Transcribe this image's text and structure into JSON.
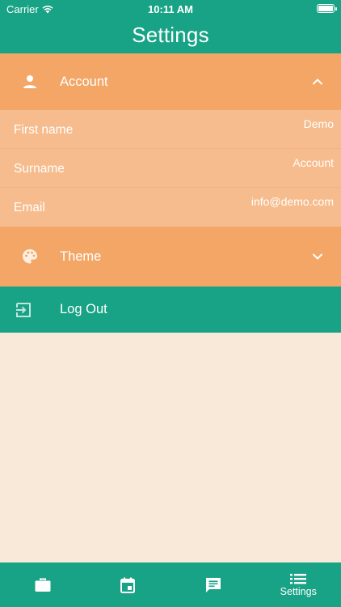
{
  "status_bar": {
    "carrier": "Carrier",
    "time": "10:11 AM"
  },
  "header": {
    "title": "Settings"
  },
  "account": {
    "label": "Account",
    "expanded": true,
    "fields": [
      {
        "label": "First name",
        "value": "Demo"
      },
      {
        "label": "Surname",
        "value": "Account"
      },
      {
        "label": "Email",
        "value": "info@demo.com"
      }
    ]
  },
  "theme": {
    "label": "Theme",
    "expanded": false
  },
  "logout": {
    "label": "Log Out"
  },
  "tabbar": {
    "tabs": [
      {
        "icon": "briefcase-icon",
        "label": ""
      },
      {
        "icon": "calendar-icon",
        "label": ""
      },
      {
        "icon": "chat-icon",
        "label": ""
      },
      {
        "icon": "list-icon",
        "label": "Settings",
        "active": true
      }
    ]
  },
  "colors": {
    "primary": "#18a386",
    "accent_orange": "#f3a666",
    "field_orange": "#f6bc8d",
    "background": "#f9e9d9"
  }
}
